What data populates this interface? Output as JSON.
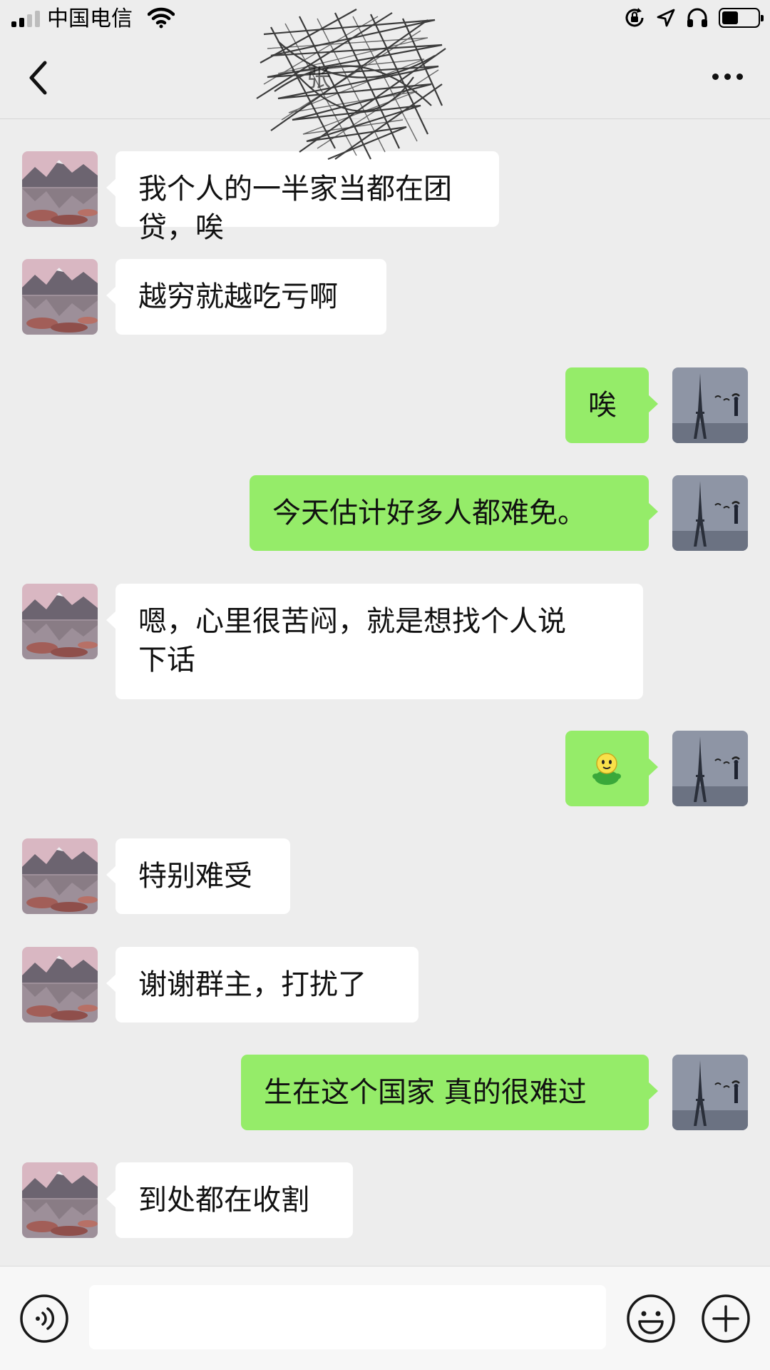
{
  "status_bar": {
    "carrier": "中国电信",
    "time": "19:23"
  },
  "nav": {
    "title": "张",
    "back_icon": "chevron-left-icon",
    "more_icon": "ellipsis-icon"
  },
  "messages": [
    {
      "side": "left",
      "text": "我个人的一半家当都在团贷，唉"
    },
    {
      "side": "left",
      "text": "越穷就越吃亏啊"
    },
    {
      "side": "right",
      "text": "唉"
    },
    {
      "side": "right",
      "text": "今天估计好多人都难免。"
    },
    {
      "side": "left",
      "text": "嗯，心里很苦闷，就是想找个人说\n下话"
    },
    {
      "side": "right",
      "emoji": "green-figure-emoji"
    },
    {
      "side": "left",
      "text": "特别难受"
    },
    {
      "side": "left",
      "text": "谢谢群主，打扰了"
    },
    {
      "side": "right",
      "text": "生在这个国家 真的很难过"
    },
    {
      "side": "left",
      "text": "到处都在收割"
    }
  ],
  "input_bar": {
    "voice_icon": "voice-icon",
    "emoji_icon": "smiley-icon",
    "plus_icon": "plus-circle-icon",
    "input_value": ""
  },
  "colors": {
    "background": "#ededed",
    "sent_bubble": "#95ec69",
    "received_bubble": "#ffffff"
  }
}
